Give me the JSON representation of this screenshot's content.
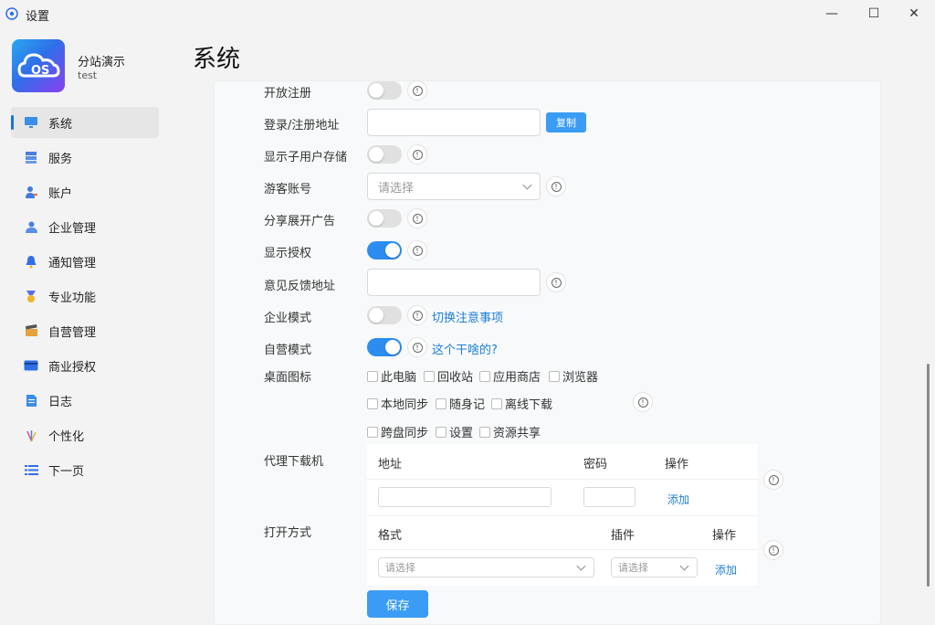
{
  "window": {
    "title": "设置",
    "minimize": "—",
    "maximize": "☐",
    "close": "✕"
  },
  "site": {
    "name": "分站演示",
    "sub": "test",
    "logo_text": "OS"
  },
  "nav": [
    {
      "label": "系统",
      "icon": "monitor-icon",
      "active": true
    },
    {
      "label": "服务",
      "icon": "server-icon"
    },
    {
      "label": "账户",
      "icon": "user-icon"
    },
    {
      "label": "企业管理",
      "icon": "enterprise-icon"
    },
    {
      "label": "通知管理",
      "icon": "bell-icon"
    },
    {
      "label": "专业功能",
      "icon": "medal-icon"
    },
    {
      "label": "自营管理",
      "icon": "clapper-icon"
    },
    {
      "label": "商业授权",
      "icon": "card-icon"
    },
    {
      "label": "日志",
      "icon": "document-icon"
    },
    {
      "label": "个性化",
      "icon": "firework-icon"
    },
    {
      "label": "下一页",
      "icon": "list-icon"
    }
  ],
  "page_title": "系统",
  "form": {
    "open_register": {
      "label": "开放注册",
      "on": false
    },
    "login_url": {
      "label": "登录/注册地址",
      "value": "",
      "copy": "复制"
    },
    "show_sub_storage": {
      "label": "显示子用户存储",
      "on": false
    },
    "guest_account": {
      "label": "游客账号",
      "placeholder": "请选择"
    },
    "share_ad": {
      "label": "分享展开广告",
      "on": false
    },
    "show_license": {
      "label": "显示授权",
      "on": true
    },
    "feedback_url": {
      "label": "意见反馈地址",
      "value": ""
    },
    "enterprise_mode": {
      "label": "企业模式",
      "on": false,
      "link": "切换注意事项"
    },
    "self_mode": {
      "label": "自营模式",
      "on": true,
      "link": "这个干啥的?"
    },
    "desktop_icons": {
      "label": "桌面图标",
      "items": [
        "此电脑",
        "回收站",
        "应用商店",
        "浏览器",
        "本地同步",
        "随身记",
        "离线下载",
        "跨盘同步",
        "设置",
        "资源共享"
      ]
    },
    "proxy": {
      "label": "代理下载机",
      "headers": [
        "地址",
        "密码",
        "操作"
      ],
      "add": "添加"
    },
    "open_with": {
      "label": "打开方式",
      "headers": [
        "格式",
        "插件",
        "操作"
      ],
      "format_placeholder": "请选择",
      "plugin_placeholder": "请选择",
      "add": "添加"
    },
    "save": "保存",
    "info_glyph": "!"
  },
  "colors": {
    "accent": "#2d8cf0",
    "link": "#1e7fd8"
  }
}
